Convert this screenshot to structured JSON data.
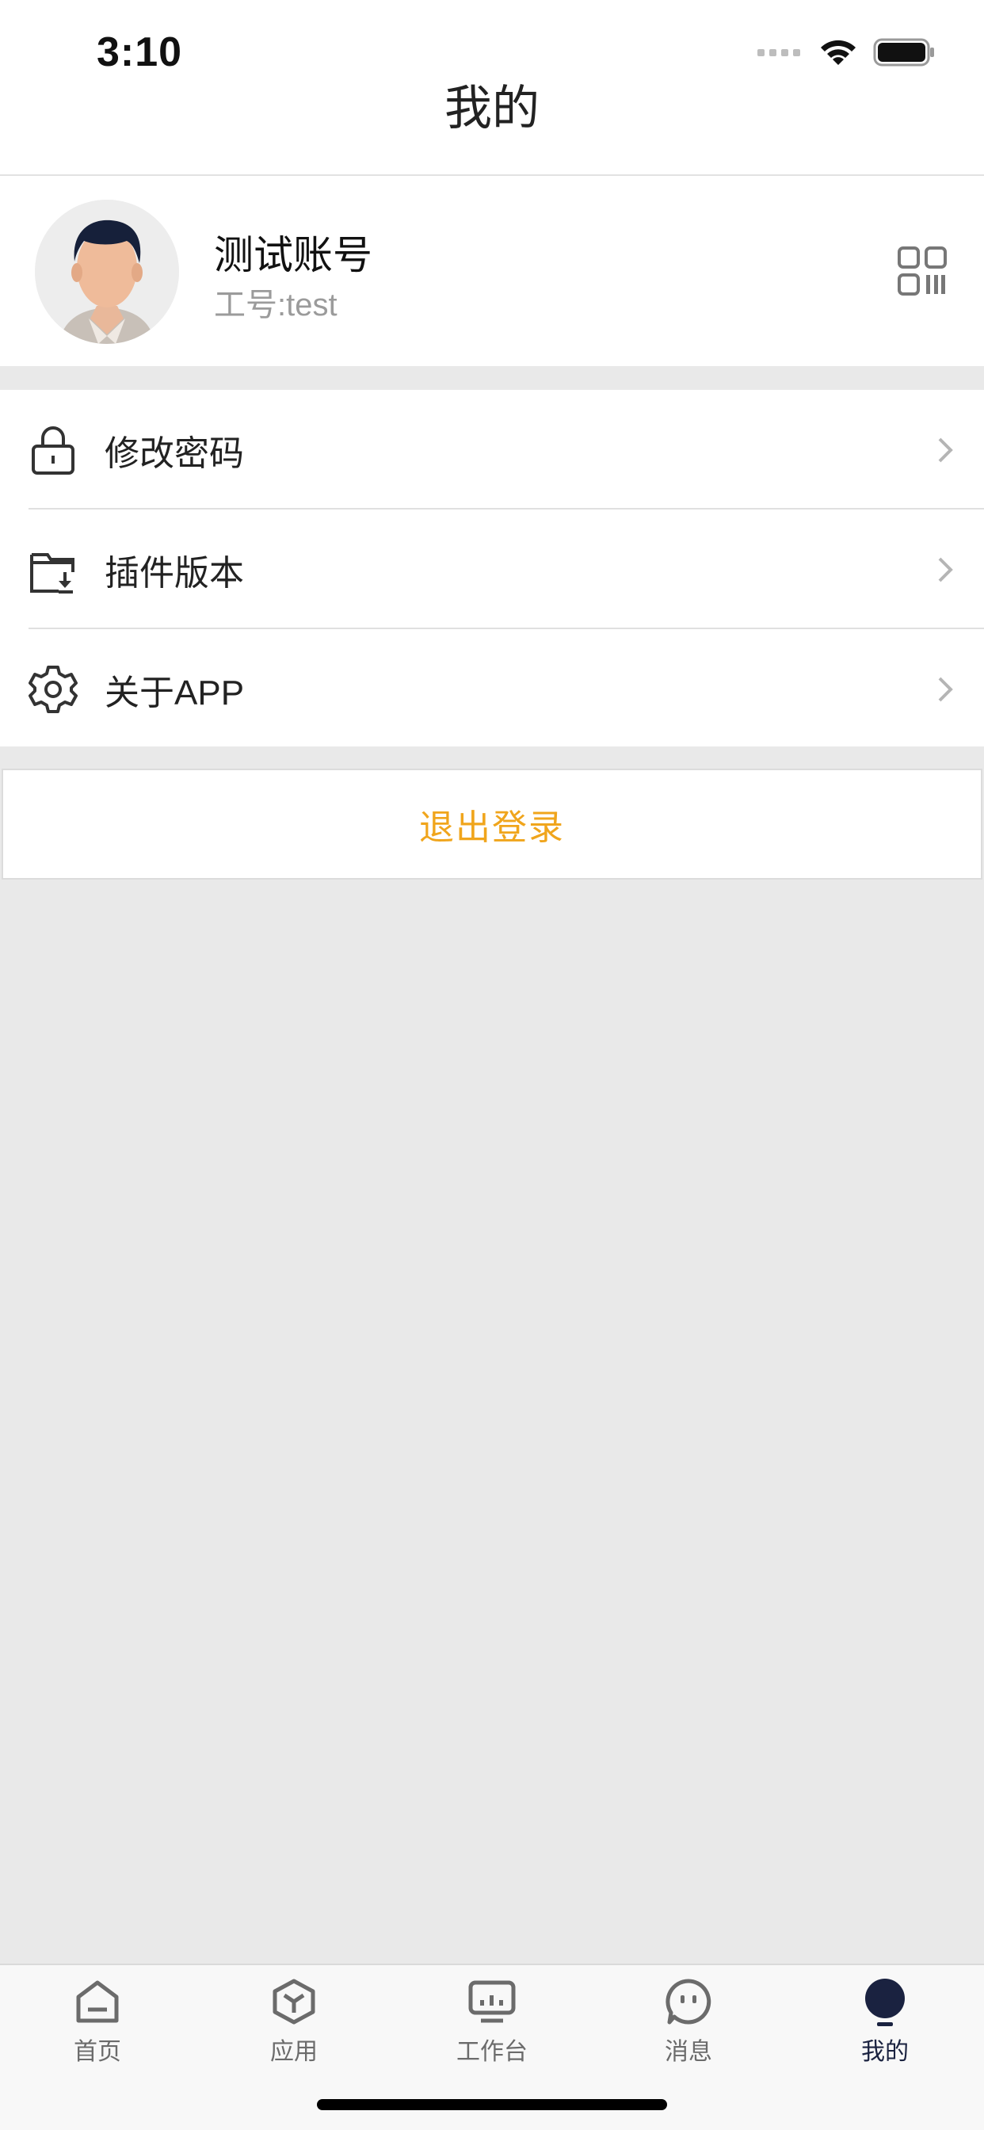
{
  "status_bar": {
    "time": "3:10"
  },
  "nav": {
    "title": "我的"
  },
  "profile": {
    "name": "测试账号",
    "employee_id": "工号:test"
  },
  "menu": {
    "items": [
      {
        "label": "修改密码",
        "icon": "lock-icon"
      },
      {
        "label": "插件版本",
        "icon": "plugin-download-icon"
      },
      {
        "label": "关于APP",
        "icon": "gear-icon"
      }
    ]
  },
  "logout": {
    "label": "退出登录"
  },
  "tabbar": {
    "items": [
      {
        "label": "首页",
        "icon": "home-icon"
      },
      {
        "label": "应用",
        "icon": "cube-icon"
      },
      {
        "label": "工作台",
        "icon": "workbench-icon"
      },
      {
        "label": "消息",
        "icon": "message-icon"
      },
      {
        "label": "我的",
        "icon": "profile-icon",
        "active": true
      }
    ]
  },
  "colors": {
    "accent_logout": "#f0a51c",
    "tab_active": "#1a2240",
    "tab_inactive": "#6b6b6b",
    "page_background": "#e9e9e9"
  }
}
